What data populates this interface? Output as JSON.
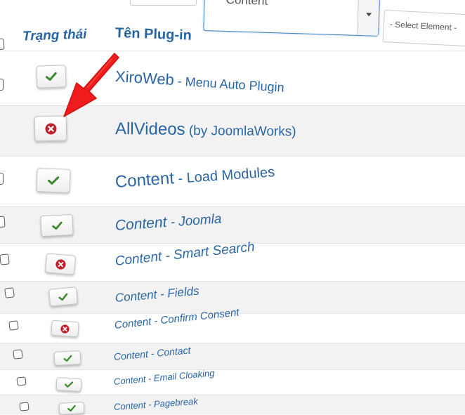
{
  "filters": {
    "folder_select_value": "Content",
    "element_select_value": "- Select Element -"
  },
  "table": {
    "headers": {
      "status": "Trạng thái",
      "name": "Tên Plug-in"
    },
    "rows": [
      {
        "status": "enabled",
        "name_main": "XiroWeb",
        "name_sub": " - Menu Auto Plugin"
      },
      {
        "status": "disabled",
        "name_main": "AllVideos",
        "name_sub": " (by JoomlaWorks)"
      },
      {
        "status": "enabled",
        "name_main": "Content",
        "name_sub": " - Load Modules"
      },
      {
        "status": "enabled",
        "name_main": "Content",
        "name_sub": " - Joomla"
      },
      {
        "status": "disabled",
        "name_main": "Content",
        "name_sub": " - Smart Search"
      },
      {
        "status": "enabled",
        "name_main": "Content",
        "name_sub": " - Fields"
      },
      {
        "status": "disabled",
        "name_main": "Content",
        "name_sub": " - Confirm Consent"
      },
      {
        "status": "enabled",
        "name_main": "Content",
        "name_sub": " - Contact"
      },
      {
        "status": "enabled",
        "name_main": "Content",
        "name_sub": " - Email Cloaking"
      },
      {
        "status": "enabled",
        "name_main": "Content",
        "name_sub": " - Pagebreak"
      }
    ]
  },
  "icons": {
    "enabled": "check-icon",
    "disabled": "unpublish-icon",
    "annotation": "red-arrow-icon"
  },
  "colors": {
    "link": "#2a65a3",
    "enabled": "#3a8a2a",
    "disabled": "#c0202a",
    "arrow": "#ee1c1c",
    "row_alt": "#f2f2f2"
  }
}
